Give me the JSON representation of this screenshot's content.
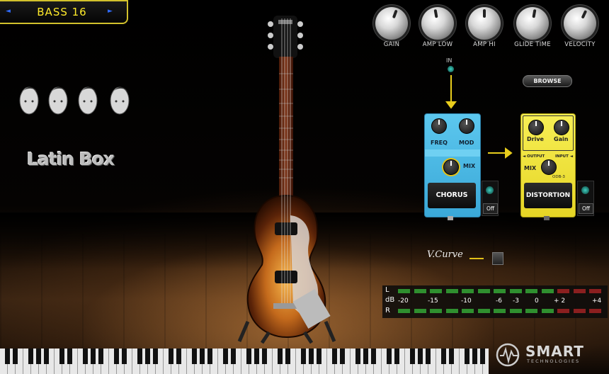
{
  "preset": {
    "name": "BASS 16",
    "prev_symbol": "◄",
    "next_symbol": "►"
  },
  "brand": {
    "name": "Latin Box"
  },
  "knobs": [
    {
      "label": "GAIN",
      "rotation_deg": 20
    },
    {
      "label": "AMP LOW",
      "rotation_deg": -10
    },
    {
      "label": "AMP HI",
      "rotation_deg": 0
    },
    {
      "label": "GLIDE TIME",
      "rotation_deg": 10
    },
    {
      "label": "VELOCITY",
      "rotation_deg": 25
    }
  ],
  "input": {
    "label": "IN"
  },
  "browse": {
    "label": "BROWSE"
  },
  "chorus": {
    "knob1": "FREQ",
    "knob2": "MOD",
    "mix": "MIX",
    "name": "CHORUS",
    "toggle": "Off"
  },
  "distortion": {
    "knob1": "Drive",
    "knob2": "Gain",
    "output": "◄ OUTPUT",
    "input": "INPUT ◄",
    "mix": "MIX",
    "model": "ODB-3",
    "name": "DISTORTION",
    "toggle": "Off"
  },
  "vcurve": {
    "label": "V.Curve"
  },
  "meter": {
    "left_label": "L",
    "db_label": "dB",
    "right_label": "R",
    "scale": [
      "-20",
      "-15",
      "-10",
      "-6",
      "-3",
      "0",
      "+ 2",
      "+4"
    ]
  },
  "logo": {
    "name": "SMART",
    "tagline": "TECHNOLOGIES"
  },
  "colors": {
    "accent_yellow": "#e2c018",
    "chorus_blue": "#4db8e4",
    "dist_yellow": "#efe23a",
    "meter_green": "#2f8f2f",
    "meter_red": "#8a1f1f"
  }
}
